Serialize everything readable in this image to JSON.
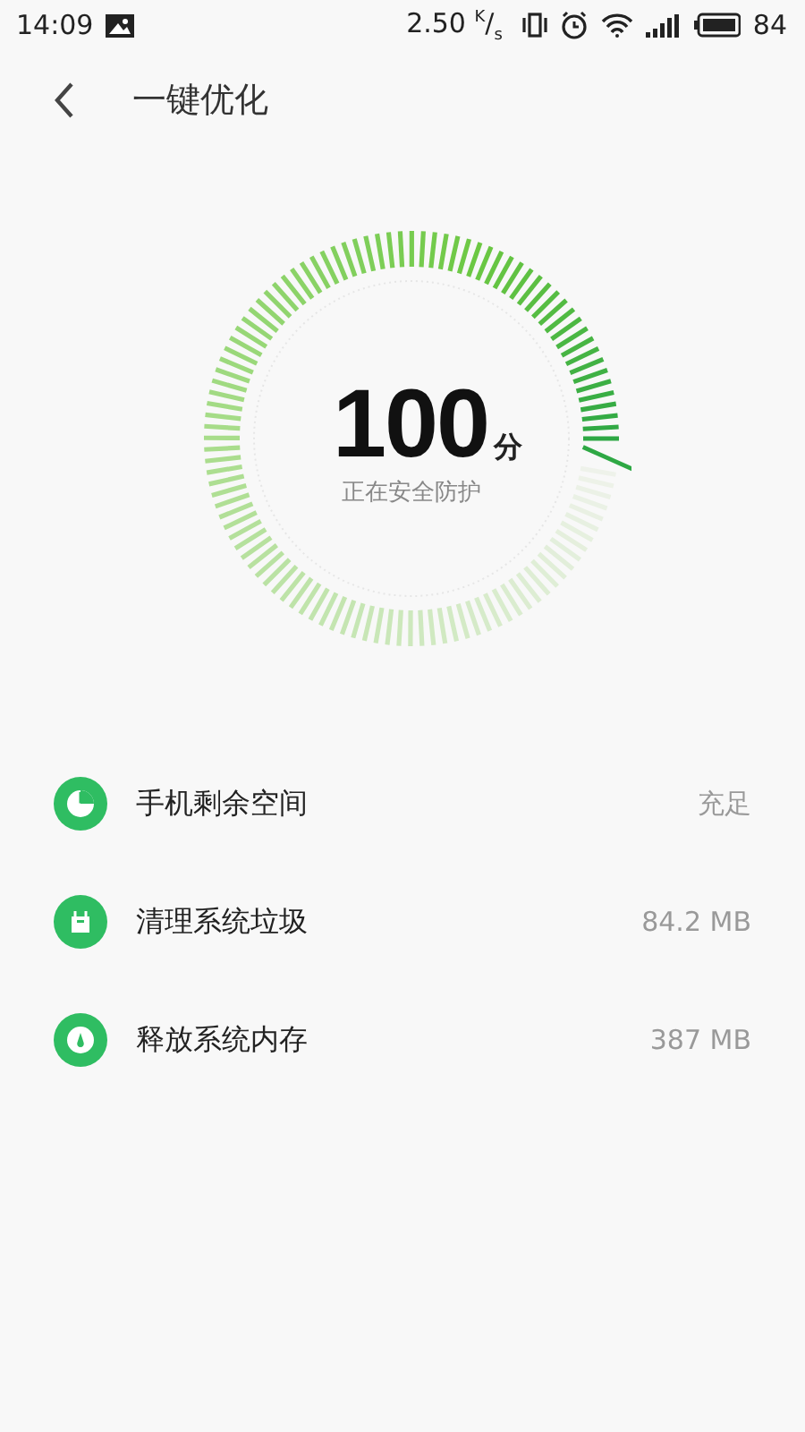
{
  "status_bar": {
    "time": "14:09",
    "speed": "2.50 $^{K}$/$_{s}$",
    "battery": "84"
  },
  "header": {
    "title": "一键优化"
  },
  "score": {
    "value": "100",
    "unit": "分",
    "caption": "正在安全防护"
  },
  "items": [
    {
      "kind": "storage",
      "label": "手机剩余空间",
      "value": "充足"
    },
    {
      "kind": "junk",
      "label": "清理系统垃圾",
      "value": "84.2 MB"
    },
    {
      "kind": "memory",
      "label": "释放系统内存",
      "value": "387 MB"
    }
  ]
}
